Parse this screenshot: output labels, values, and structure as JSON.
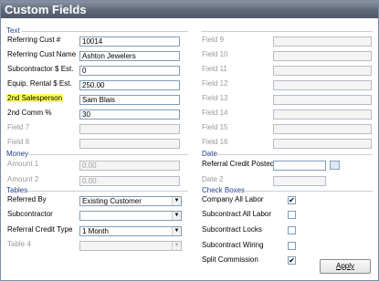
{
  "window": {
    "title": "Custom Fields"
  },
  "text_section": {
    "label": "Text",
    "left_fields": [
      {
        "label": "Referring Cust #",
        "value": "10014",
        "enabled": true,
        "highlight": false
      },
      {
        "label": "Referring Cust Name",
        "value": "Ashton Jewelers",
        "enabled": true,
        "highlight": false
      },
      {
        "label": "Subcontractor $ Est.",
        "value": "0",
        "enabled": true,
        "highlight": false
      },
      {
        "label": "Equip. Rental $ Est.",
        "value": "250.00",
        "enabled": true,
        "highlight": false
      },
      {
        "label": "2nd Salesperson",
        "value": "Sam Blais",
        "enabled": true,
        "highlight": true
      },
      {
        "label": "2nd Comm %",
        "value": "30",
        "enabled": true,
        "highlight": false
      },
      {
        "label": "Field 7",
        "value": "",
        "enabled": false,
        "highlight": false
      },
      {
        "label": "Field 8",
        "value": "",
        "enabled": false,
        "highlight": false
      }
    ],
    "right_fields": [
      {
        "label": "Field 9"
      },
      {
        "label": "Field 10"
      },
      {
        "label": "Field 11"
      },
      {
        "label": "Field 12"
      },
      {
        "label": "Field 13"
      },
      {
        "label": "Field 14"
      },
      {
        "label": "Field 15"
      },
      {
        "label": "Field 16"
      }
    ]
  },
  "money_section": {
    "label": "Money",
    "fields": [
      {
        "label": "Amount 1",
        "value": "0.00"
      },
      {
        "label": "Amount 2",
        "value": "0.00"
      }
    ]
  },
  "date_section": {
    "label": "Date",
    "fields": [
      {
        "label": "Referral Credit Posted",
        "value": ""
      },
      {
        "label": "Date 2",
        "value": ""
      }
    ]
  },
  "tables_section": {
    "label": "Tables",
    "fields": [
      {
        "label": "Referred By",
        "value": "Existing Customer"
      },
      {
        "label": "Subcontractor",
        "value": ""
      },
      {
        "label": "Referral Credit Type",
        "value": "1 Month"
      },
      {
        "label": "Table 4",
        "value": ""
      }
    ]
  },
  "checkboxes_section": {
    "label": "Check Boxes",
    "items": [
      {
        "label": "Company All Labor",
        "checked": true
      },
      {
        "label": "Subcontract All Labor",
        "checked": false
      },
      {
        "label": "Subcontract Locks",
        "checked": false
      },
      {
        "label": "Subcontract Wiring",
        "checked": false
      },
      {
        "label": "Split Commission",
        "checked": true
      }
    ]
  },
  "buttons": {
    "apply": "Apply"
  },
  "colors": {
    "section_label": "#1f3d8a",
    "highlight": "#ffff66",
    "titlebar": "#5f6878"
  }
}
